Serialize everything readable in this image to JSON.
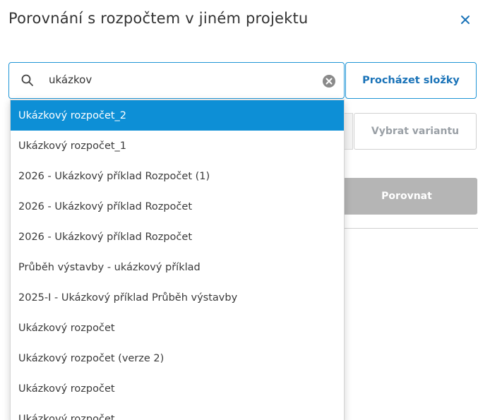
{
  "dialog": {
    "title": "Porovnání s rozpočtem v jiném projektu",
    "close_icon": "close-icon"
  },
  "search": {
    "value": "ukázkov",
    "search_icon": "search-icon",
    "clear_icon": "clear-circle-icon"
  },
  "browse_button_label": "Procházet složky",
  "variant_button_label": "Vybrat variantu",
  "compare_button_label": "Porovnat",
  "colors": {
    "accent": "#0d8fd6",
    "link": "#1a73b8",
    "disabled": "#b5b5b5"
  },
  "dropdown": {
    "selected_index": 0,
    "options": [
      "Ukázkový rozpočet_2",
      "Ukázkový rozpočet_1",
      "2026 - Ukázkový příklad Rozpočet (1)",
      "2026 - Ukázkový příklad Rozpočet",
      "2026 - Ukázkový příklad Rozpočet",
      "Průběh výstavby - ukázkový příklad",
      "2025-I - Ukázkový příklad Průběh výstavby",
      "Ukázkový rozpočet",
      "Ukázkový rozpočet (verze 2)",
      "Ukázkový rozpočet",
      "Ukázkový rozpočet"
    ]
  }
}
